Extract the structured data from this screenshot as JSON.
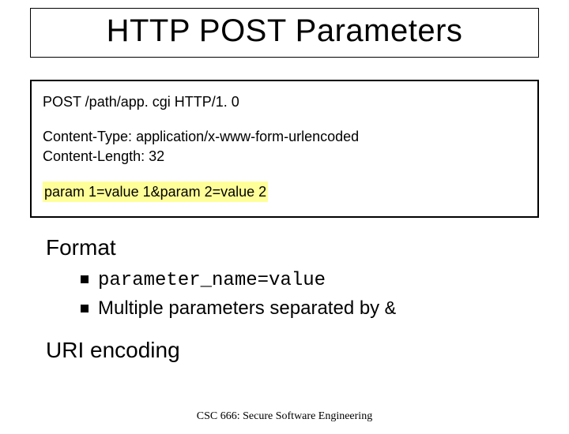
{
  "title": "HTTP POST Parameters",
  "code": {
    "request_line": "POST /path/app. cgi HTTP/1. 0",
    "header1": "Content-Type: application/x-www-form-urlencoded",
    "header2": "Content-Length: 32",
    "body": "param 1=value 1&param 2=value 2"
  },
  "section1": {
    "heading": "Format",
    "bullet1_code": "parameter_name=value",
    "bullet2_text": "Multiple parameters separated by ",
    "bullet2_code": "&"
  },
  "section2": {
    "heading": "URI encoding"
  },
  "footer": "CSC 666: Secure Software Engineering"
}
